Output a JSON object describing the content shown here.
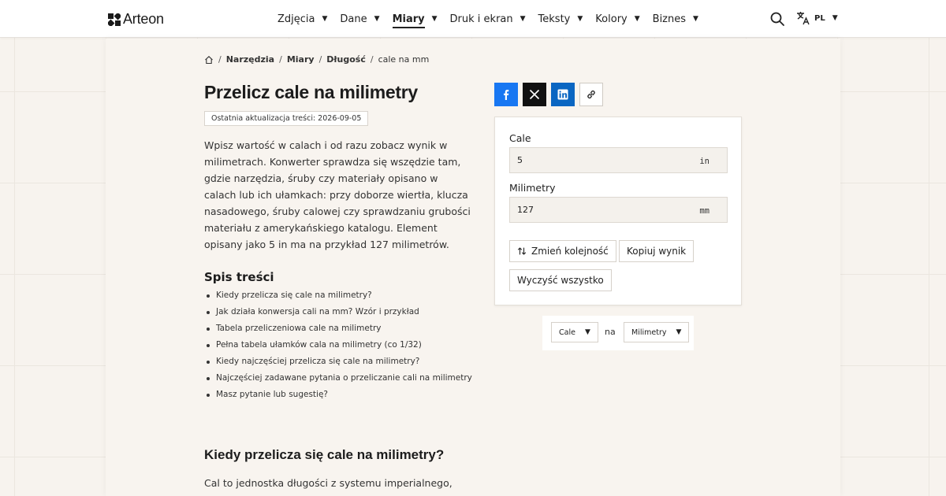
{
  "header": {
    "logo_text": "Arteon",
    "nav": [
      {
        "label": "Zdjęcia"
      },
      {
        "label": "Dane"
      },
      {
        "label": "Miary",
        "active": true
      },
      {
        "label": "Druk i ekran"
      },
      {
        "label": "Teksty"
      },
      {
        "label": "Kolory"
      },
      {
        "label": "Biznes"
      }
    ],
    "lang": "PL",
    "icons": [
      "search-icon",
      "translate-icon"
    ]
  },
  "breadcrumb": {
    "items": [
      "Narzędzia",
      "Miary",
      "Długość"
    ],
    "current": "cale na mm"
  },
  "page": {
    "title": "Przelicz cale na milimetry",
    "updated": "Ostatnia aktualizacja treści: 2026-09-05",
    "intro": "Wpisz wartość w calach i od razu zobacz wynik w milimetrach. Konwerter sprawdza się wszędzie tam, gdzie narzędzia, śruby czy materiały opisano w calach lub ich ułamkach: przy doborze wiertła, klucza nasadowego, śruby calowej czy sprawdzaniu grubości materiału z amerykańskiego katalogu. Element opisany jako 5 in ma na przykład 127 milimetrów."
  },
  "toc": {
    "title": "Spis treści",
    "items": [
      "Kiedy przelicza się cale na milimetry?",
      "Jak działa konwersja cali na mm? Wzór i przykład",
      "Tabela przeliczeniowa cale na milimetry",
      "Pełna tabela ułamków cala na milimetry (co 1/32)",
      "Kiedy najczęściej przelicza się cale na milimetry?",
      "Najczęściej zadawane pytania o przeliczanie cali na milimetry",
      "Masz pytanie lub sugestię?"
    ]
  },
  "section": {
    "title": "Kiedy przelicza się cale na milimetry?",
    "text": "Cal to jednostka długości z systemu imperialnego,"
  },
  "converter": {
    "from_label": "Cale",
    "from_value": "5",
    "from_unit": "in",
    "to_label": "Milimetry",
    "to_value": "127",
    "to_unit": "mm",
    "swap_button": "Zmień kolejność",
    "copy_button": "Kopiuj wynik",
    "clear_button": "Wyczyść wszystko"
  },
  "unit_selector": {
    "from": "Cale",
    "separator": "na",
    "to": "Milimetry"
  },
  "colors": {
    "facebook": "#1877f2",
    "x": "#111111",
    "linkedin": "#0a66c2",
    "background": "#f7f3ee"
  }
}
